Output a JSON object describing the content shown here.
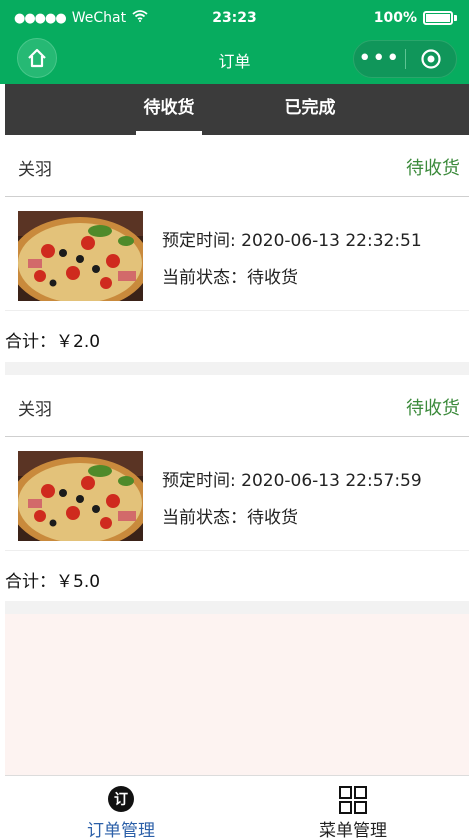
{
  "status_bar": {
    "signal_dots": "●●●●●",
    "carrier": "WeChat",
    "time": "23:23",
    "battery": "100%"
  },
  "navbar": {
    "title": "订单",
    "more_glyph": "•••"
  },
  "tabs": [
    {
      "label": "待收货",
      "active": true
    },
    {
      "label": "已完成",
      "active": false
    }
  ],
  "orders": [
    {
      "customer": "关羽",
      "status": "待收货",
      "reserve_time": "预定时间: 2020-06-13 22:32:51",
      "current_status": "当前状态：待收货",
      "total": "合计：￥2.0"
    },
    {
      "customer": "关羽",
      "status": "待收货",
      "reserve_time": "预定时间: 2020-06-13 22:57:59",
      "current_status": "当前状态：待收货",
      "total": "合计：￥5.0"
    }
  ],
  "tabbar": [
    {
      "label": "订单管理",
      "icon": "order-badge-icon",
      "icon_text": "订",
      "active": true
    },
    {
      "label": "菜单管理",
      "icon": "grid-menu-icon",
      "active": false
    }
  ],
  "colors": {
    "brand_green": "#07ac5f",
    "tab_bg": "#3b3b3b",
    "status_green": "#3b8a3b",
    "active_tab_blue": "#2b5fa8"
  }
}
